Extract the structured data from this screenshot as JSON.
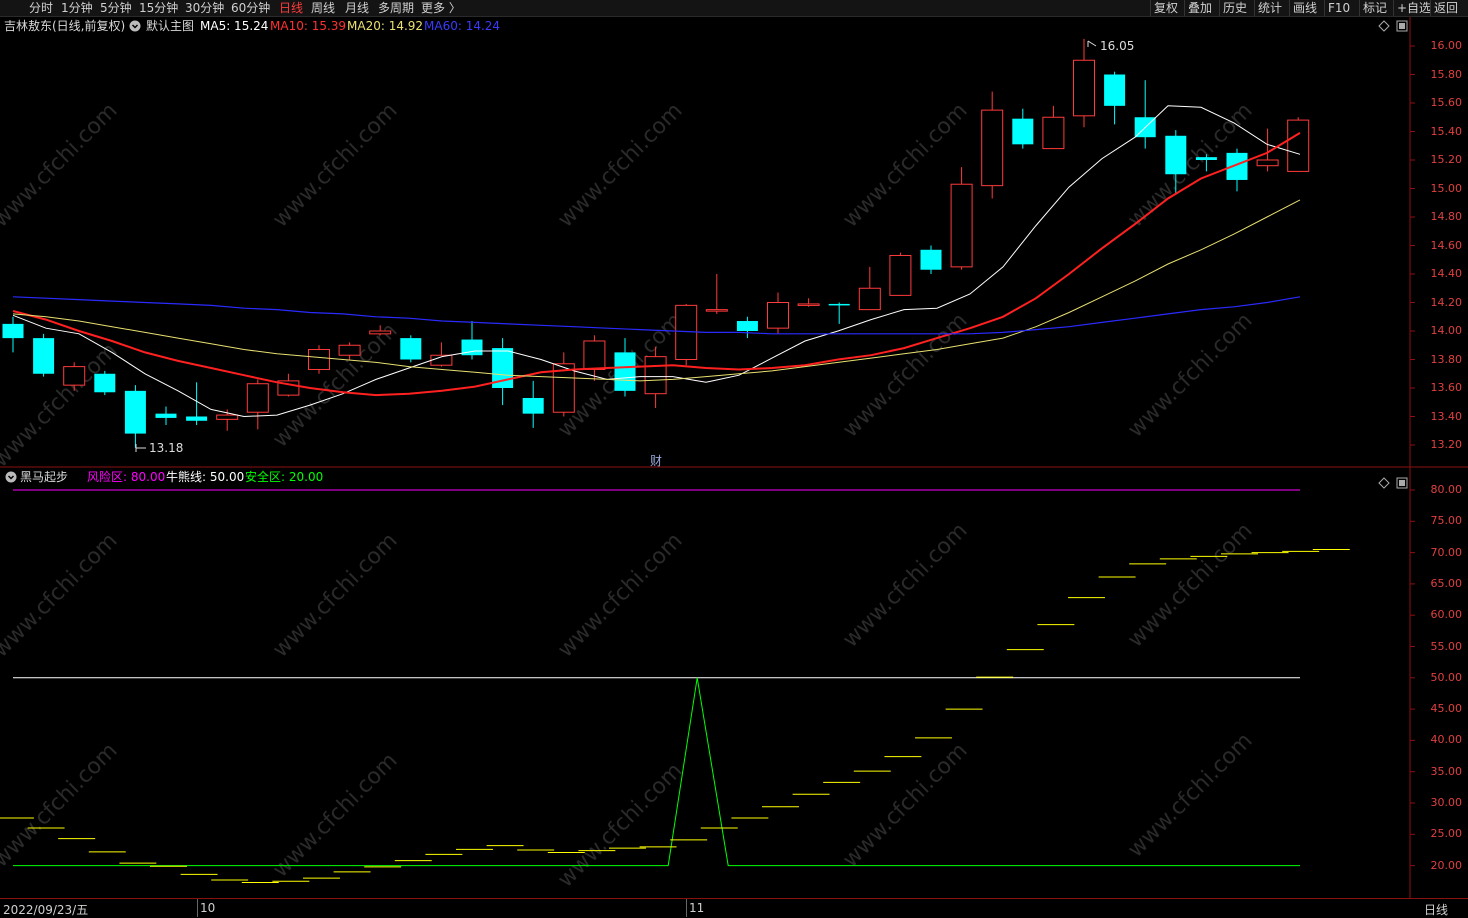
{
  "topbar": {
    "periods": [
      "分时",
      "1分钟",
      "5分钟",
      "15分钟",
      "30分钟",
      "60分钟",
      "日线",
      "周线",
      "月线",
      "多周期",
      "更多 〉"
    ],
    "active_index": 6,
    "right_buttons": [
      "复权",
      "叠加",
      "历史",
      "统计",
      "画线",
      "F10",
      "标记",
      "+自选",
      "返回"
    ]
  },
  "main_panel": {
    "stock_name": "吉林敖东(日线,前复权)",
    "template_label": "默认主图",
    "ma5": "MA5: 15.24",
    "ma10": "MA10: 15.39",
    "ma20": "MA20: 14.92",
    "ma60": "MA60: 14.24",
    "high_label": "16.05",
    "low_label": "13.18",
    "event_marker": "财",
    "axis_labels": [
      "16.00",
      "15.80",
      "15.60",
      "15.40",
      "15.20",
      "15.00",
      "14.80",
      "14.60",
      "14.40",
      "14.20",
      "14.00",
      "13.80",
      "13.60",
      "13.40",
      "13.20"
    ]
  },
  "sub_panel": {
    "indicator_name": "黑马起步",
    "risk_zone": "风险区: 80.00",
    "bull_bear_line": "牛熊线: 50.00",
    "safe_zone": "安全区: 20.00",
    "axis_labels": [
      "80.00",
      "75.00",
      "70.00",
      "65.00",
      "60.00",
      "55.00",
      "50.00",
      "45.00",
      "40.00",
      "35.00",
      "30.00",
      "25.00",
      "20.00"
    ]
  },
  "bottombar": {
    "date": "2022/09/23/五",
    "month_labels": [
      "10",
      "11"
    ],
    "period_label": "日线"
  },
  "colors": {
    "up": "#ff3b3b",
    "down": "#00ffff",
    "ma5": "#ffffff",
    "ma10": "#ff2020",
    "ma20": "#e8e070",
    "ma60": "#2a2aff",
    "risk": "#ff00ff",
    "bull": "#ffffff",
    "safe": "#00ff00",
    "indicator": "#ffff00",
    "axis": "#e04040"
  },
  "chart_data": [
    {
      "type": "candlestick",
      "series": [
        {
          "name": "MA5",
          "values": [
            14.11,
            14.02,
            13.98,
            13.85,
            13.7,
            13.58,
            13.45,
            13.4,
            13.41,
            13.48,
            13.56,
            13.66,
            13.74,
            13.82,
            13.86,
            13.86,
            13.8,
            13.72,
            13.66,
            13.68,
            13.68,
            13.64,
            13.69,
            13.81,
            13.93,
            14.0,
            14.08,
            14.15,
            14.16,
            14.26,
            14.45,
            14.74,
            15.01,
            15.21,
            15.36,
            15.58,
            15.57,
            15.46,
            15.31,
            15.24
          ]
        },
        {
          "name": "MA10",
          "values": [
            14.14,
            14.08,
            14.0,
            13.93,
            13.85,
            13.79,
            13.74,
            13.69,
            13.64,
            13.6,
            13.57,
            13.55,
            13.56,
            13.58,
            13.61,
            13.66,
            13.71,
            13.73,
            13.74,
            13.75,
            13.76,
            13.74,
            13.73,
            13.74,
            13.76,
            13.8,
            13.83,
            13.88,
            13.95,
            14.02,
            14.1,
            14.23,
            14.4,
            14.58,
            14.75,
            14.93,
            15.07,
            15.16,
            15.25,
            15.39
          ]
        },
        {
          "name": "MA20",
          "values": [
            14.12,
            14.1,
            14.07,
            14.03,
            13.99,
            13.95,
            13.91,
            13.87,
            13.84,
            13.82,
            13.8,
            13.78,
            13.75,
            13.73,
            13.71,
            13.69,
            13.68,
            13.67,
            13.66,
            13.65,
            13.66,
            13.68,
            13.7,
            13.72,
            13.75,
            13.78,
            13.81,
            13.84,
            13.87,
            13.91,
            13.95,
            14.03,
            14.13,
            14.24,
            14.35,
            14.47,
            14.57,
            14.68,
            14.8,
            14.92
          ]
        },
        {
          "name": "MA60",
          "values": [
            14.24,
            14.23,
            14.22,
            14.21,
            14.2,
            14.19,
            14.18,
            14.16,
            14.15,
            14.13,
            14.12,
            14.1,
            14.09,
            14.07,
            14.06,
            14.05,
            14.04,
            14.03,
            14.02,
            14.01,
            14.0,
            13.99,
            13.99,
            13.98,
            13.98,
            13.98,
            13.98,
            13.98,
            13.98,
            13.98,
            13.99,
            14.01,
            14.03,
            14.06,
            14.09,
            14.12,
            14.15,
            14.17,
            14.2,
            14.24
          ]
        }
      ],
      "ylim": [
        13.1,
        16.1
      ],
      "candles": [
        [
          14.05,
          13.95,
          14.1,
          13.85
        ],
        [
          13.95,
          13.7,
          13.98,
          13.68
        ],
        [
          13.62,
          13.75,
          13.78,
          13.58
        ],
        [
          13.7,
          13.57,
          13.72,
          13.55
        ],
        [
          13.58,
          13.28,
          13.62,
          13.18
        ],
        [
          13.42,
          13.39,
          13.47,
          13.34
        ],
        [
          13.4,
          13.37,
          13.64,
          13.34
        ],
        [
          13.38,
          13.41,
          13.45,
          13.3
        ],
        [
          13.43,
          13.63,
          13.66,
          13.31
        ],
        [
          13.55,
          13.65,
          13.7,
          13.54
        ],
        [
          13.73,
          13.87,
          13.9,
          13.7
        ],
        [
          13.83,
          13.9,
          13.92,
          13.8
        ],
        [
          13.98,
          14.0,
          14.04,
          13.97
        ],
        [
          13.95,
          13.8,
          13.97,
          13.78
        ],
        [
          13.76,
          13.83,
          13.92,
          13.75
        ],
        [
          13.94,
          13.83,
          14.07,
          13.8
        ],
        [
          13.88,
          13.6,
          13.95,
          13.48
        ],
        [
          13.53,
          13.42,
          13.65,
          13.32
        ],
        [
          13.43,
          13.77,
          13.85,
          13.4
        ],
        [
          13.73,
          13.93,
          13.97,
          13.65
        ],
        [
          13.85,
          13.58,
          13.95,
          13.54
        ],
        [
          13.56,
          13.82,
          13.89,
          13.46
        ],
        [
          13.8,
          14.18,
          14.19,
          13.76
        ],
        [
          14.14,
          14.15,
          14.4,
          14.12
        ],
        [
          14.07,
          14.0,
          14.1,
          13.95
        ],
        [
          14.02,
          14.2,
          14.27,
          13.98
        ],
        [
          14.18,
          14.19,
          14.23,
          14.17
        ],
        [
          14.19,
          14.18,
          14.2,
          14.05
        ],
        [
          14.15,
          14.3,
          14.45,
          14.15
        ],
        [
          14.25,
          14.53,
          14.55,
          14.25
        ],
        [
          14.57,
          14.43,
          14.6,
          14.4
        ],
        [
          14.45,
          15.03,
          15.15,
          14.43
        ],
        [
          15.02,
          15.55,
          15.68,
          14.93
        ],
        [
          15.49,
          15.31,
          15.56,
          15.28
        ],
        [
          15.28,
          15.5,
          15.58,
          15.28
        ],
        [
          15.51,
          15.9,
          16.05,
          15.43
        ],
        [
          15.8,
          15.58,
          15.82,
          15.45
        ],
        [
          15.5,
          15.36,
          15.76,
          15.28
        ],
        [
          15.37,
          15.1,
          15.41,
          14.96
        ],
        [
          15.22,
          15.2,
          15.24,
          15.12
        ],
        [
          15.25,
          15.06,
          15.28,
          14.98
        ],
        [
          15.16,
          15.2,
          15.42,
          15.12
        ],
        [
          15.12,
          15.48,
          15.5,
          15.12
        ]
      ]
    },
    {
      "type": "line",
      "title": "黑马起步",
      "ylim": [
        17.0,
        82.0
      ],
      "reference_lines": [
        {
          "name": "风险区",
          "value": 80
        },
        {
          "name": "牛熊线",
          "value": 50
        },
        {
          "name": "安全区",
          "value": 20
        }
      ],
      "steps": [
        27.6,
        26.0,
        24.3,
        22.2,
        20.4,
        19.9,
        18.6,
        17.7,
        17.3,
        17.5,
        18.0,
        19.0,
        19.8,
        20.8,
        21.8,
        22.6,
        23.2,
        22.5,
        22.1,
        22.4,
        22.8,
        23.0,
        24.1,
        26.0,
        27.6,
        29.4,
        31.4,
        33.3,
        35.1,
        37.4,
        40.4,
        45.0,
        50.1,
        54.5,
        58.5,
        62.8,
        66.1,
        68.2,
        69.0,
        69.4,
        69.8,
        70.0,
        70.2,
        70.5
      ],
      "spike": {
        "base": 20,
        "peak": 50,
        "index": 22
      }
    }
  ]
}
